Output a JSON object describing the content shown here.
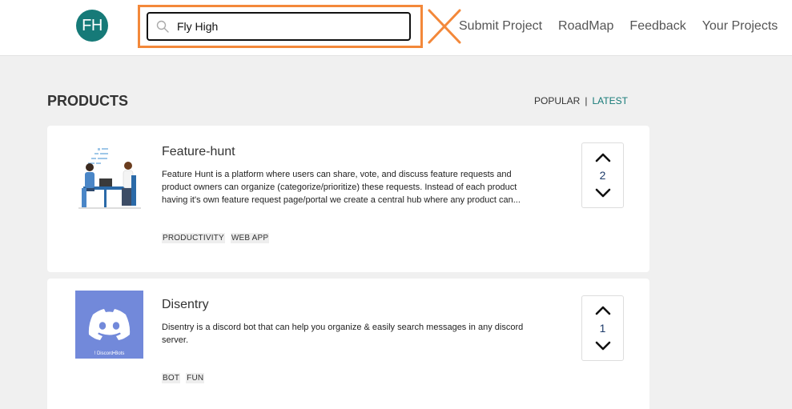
{
  "header": {
    "logo_text": "FH",
    "search": {
      "value": "Fly High",
      "placeholder": ""
    },
    "nav": [
      "Submit Project",
      "RoadMap",
      "Feedback",
      "Your Projects"
    ]
  },
  "section": {
    "title": "PRODUCTS",
    "sort": {
      "popular": "POPULAR",
      "separator": "|",
      "latest": "LATEST"
    }
  },
  "products": [
    {
      "title": "Feature-hunt",
      "description": "Feature Hunt is a platform where users can share, vote, and discuss feature requests and product owners can organize (categorize/prioritize) these requests. Instead of each product having it's own feature request page/portal we create a central hub where any product can...",
      "tags": [
        "PRODUCTIVITY",
        "WEB APP"
      ],
      "votes": "2"
    },
    {
      "title": "Disentry",
      "description": "Disentry is a discord bot that can help you organize & easily search messages in any discord server.",
      "tags": [
        "BOT",
        "FUN"
      ],
      "votes": "1",
      "thumb_caption": "! Discord•Bots"
    }
  ],
  "colors": {
    "accent": "#167a78",
    "highlight": "#f3883a",
    "discord": "#7289da"
  }
}
